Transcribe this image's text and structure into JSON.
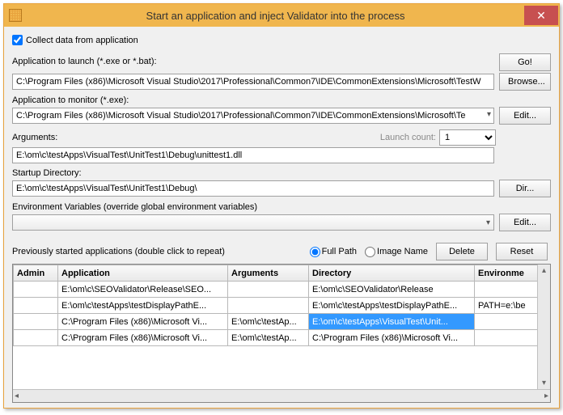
{
  "window": {
    "title": "Start an application and inject Validator into the process"
  },
  "collect_checkbox": {
    "label": "Collect data from application",
    "checked": true
  },
  "app_launch": {
    "label": "Application to launch (*.exe or *.bat):",
    "value": "C:\\Program Files (x86)\\Microsoft Visual Studio\\2017\\Professional\\Common7\\IDE\\CommonExtensions\\Microsoft\\TestW",
    "go_btn": "Go!",
    "browse_btn": "Browse..."
  },
  "app_monitor": {
    "label": "Application to monitor (*.exe):",
    "value": "C:\\Program Files (x86)\\Microsoft Visual Studio\\2017\\Professional\\Common7\\IDE\\CommonExtensions\\Microsoft\\Te",
    "edit_btn": "Edit..."
  },
  "arguments": {
    "label": "Arguments:",
    "value": "E:\\om\\c\\testApps\\VisualTest\\UnitTest1\\Debug\\unittest1.dll",
    "launch_count_label": "Launch count:",
    "launch_count_value": "1"
  },
  "startup_dir": {
    "label": "Startup Directory:",
    "value": "E:\\om\\c\\testApps\\VisualTest\\UnitTest1\\Debug\\",
    "dir_btn": "Dir..."
  },
  "env_vars": {
    "label": "Environment Variables (override global environment variables)",
    "edit_btn": "Edit..."
  },
  "history": {
    "label": "Previously started applications (double click to repeat)",
    "radio_full": "Full Path",
    "radio_image": "Image Name",
    "delete_btn": "Delete",
    "reset_btn": "Reset",
    "columns": {
      "admin": "Admin",
      "application": "Application",
      "arguments": "Arguments",
      "directory": "Directory",
      "environment": "Environme"
    },
    "rows": [
      {
        "admin": "",
        "application": "E:\\om\\c\\SEOValidator\\Release\\SEO...",
        "arguments": "",
        "directory": "E:\\om\\c\\SEOValidator\\Release",
        "env": ""
      },
      {
        "admin": "",
        "application": "E:\\om\\c\\testApps\\testDisplayPathE...",
        "arguments": "",
        "directory": "E:\\om\\c\\testApps\\testDisplayPathE...",
        "env": "PATH=e:\\be"
      },
      {
        "admin": "",
        "application": "C:\\Program Files (x86)\\Microsoft Vi...",
        "arguments": "E:\\om\\c\\testAp...",
        "directory": "E:\\om\\c\\testApps\\VisualTest\\Unit...",
        "env": "",
        "selected": true
      },
      {
        "admin": "",
        "application": "C:\\Program Files (x86)\\Microsoft Vi...",
        "arguments": "E:\\om\\c\\testAp...",
        "directory": "C:\\Program Files (x86)\\Microsoft Vi...",
        "env": ""
      }
    ]
  }
}
